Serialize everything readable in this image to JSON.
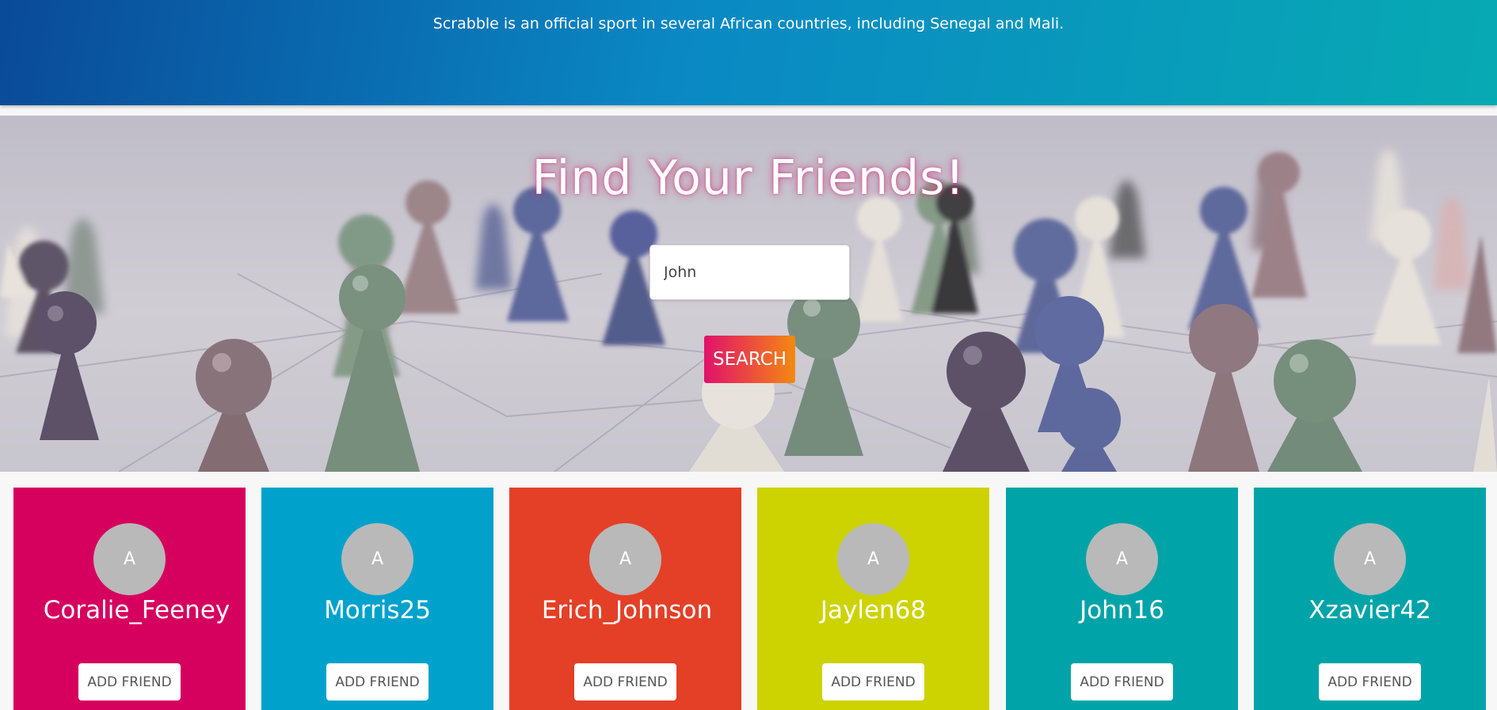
{
  "banner": {
    "fact": "Scrabble is an official sport in several African countries, including Senegal and Mali."
  },
  "hero": {
    "title": "Find Your Friends!",
    "search_value": "John",
    "search_button": "SEARCH"
  },
  "results": [
    {
      "username": "Coralie_Feeney",
      "avatar_letter": "A",
      "button": "ADD FRIEND",
      "color": "#d6005f"
    },
    {
      "username": "Morris25",
      "avatar_letter": "A",
      "button": "ADD FRIEND",
      "color": "#00a2cc"
    },
    {
      "username": "Erich_Johnson",
      "avatar_letter": "A",
      "button": "ADD FRIEND",
      "color": "#e34027"
    },
    {
      "username": "Jaylen68",
      "avatar_letter": "A",
      "button": "ADD FRIEND",
      "color": "#cdd300"
    },
    {
      "username": "John16",
      "avatar_letter": "A",
      "button": "ADD FRIEND",
      "color": "#00a4a8"
    },
    {
      "username": "Xzavier42",
      "avatar_letter": "A",
      "button": "ADD FRIEND",
      "color": "#00a4a8"
    }
  ]
}
